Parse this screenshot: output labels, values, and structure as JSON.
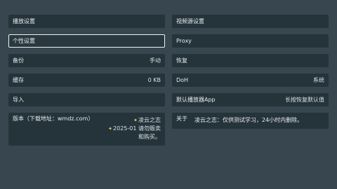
{
  "left": {
    "play_settings": "播放设置",
    "personal_settings": "个性设置",
    "backup_label": "备份",
    "backup_value": "手动",
    "cache_label": "缓存",
    "cache_value": "0 KB",
    "import_label": "导入",
    "version_label": "版本（下载地址：wmdz.com）",
    "version_note_1": "凌云之志",
    "version_note_2": "2025-01 请勿贩卖和购买。"
  },
  "right": {
    "source_settings": "视频源设置",
    "proxy_label": "Proxy",
    "restore_label": "恢复",
    "doh_label": "DoH",
    "doh_value": "系统",
    "default_app_label": "默认播放器App",
    "default_app_value": "长按恢复默认值",
    "about_label": "关于",
    "about_text": "凌云之志：仅供测试学习，24小时内删除。"
  },
  "colors": {
    "background": "#38474f",
    "panel": "#25333a",
    "focus_border": "#eef2f4",
    "accent_star": "#f2d36b"
  }
}
